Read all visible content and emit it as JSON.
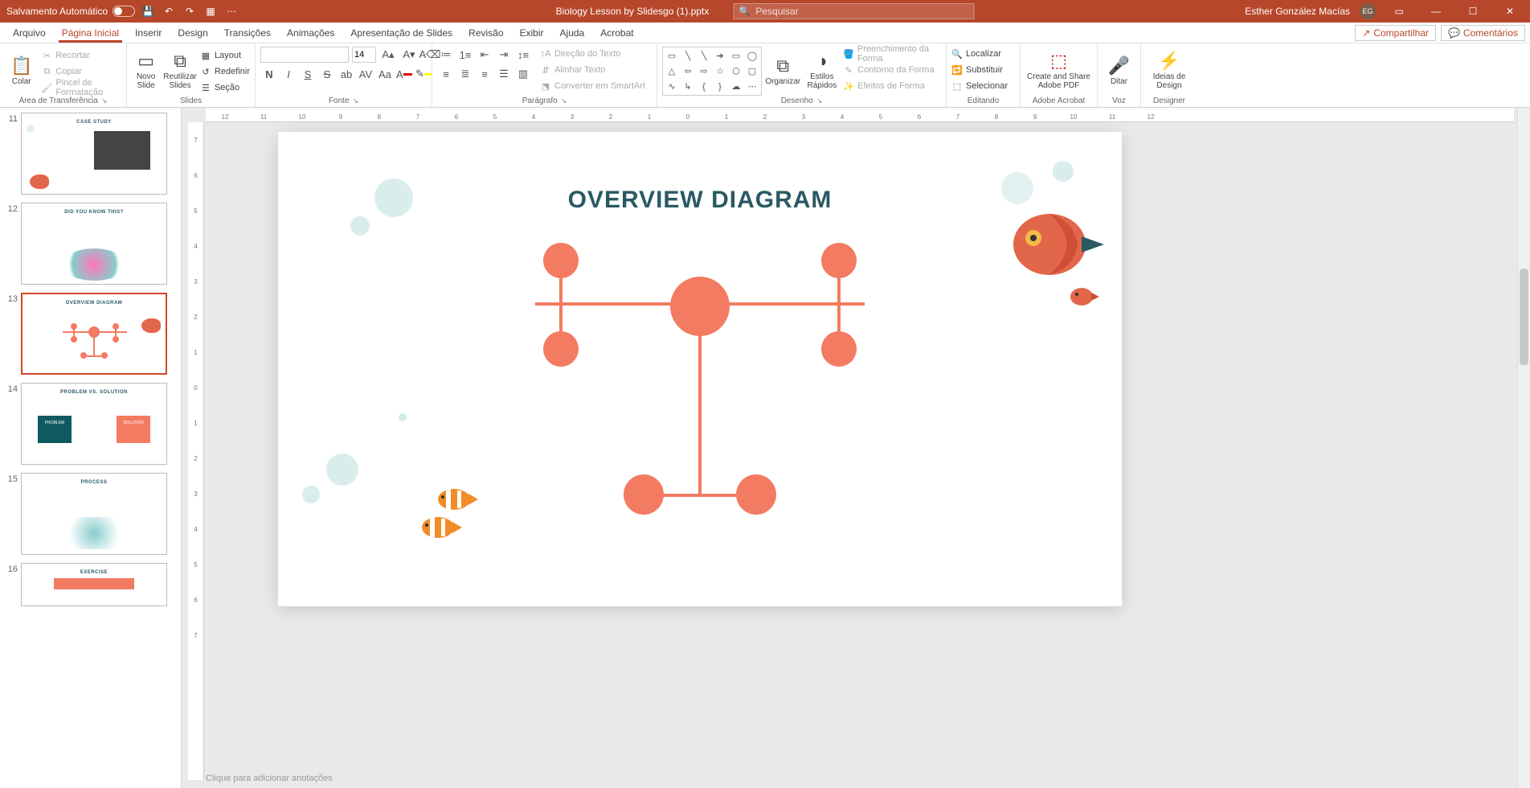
{
  "titlebar": {
    "autosave_label": "Salvamento Automático",
    "filename": "Biology Lesson by Slidesgo (1).pptx",
    "search_placeholder": "Pesquisar",
    "user_name": "Esther González Macías",
    "user_initials": "EG"
  },
  "tabs": {
    "items": [
      "Arquivo",
      "Página Inicial",
      "Inserir",
      "Design",
      "Transições",
      "Animações",
      "Apresentação de Slides",
      "Revisão",
      "Exibir",
      "Ajuda",
      "Acrobat"
    ],
    "share": "Compartilhar",
    "comments": "Comentários"
  },
  "ribbon": {
    "clipboard": {
      "paste": "Colar",
      "cut": "Recortar",
      "copy": "Copiar",
      "format_painter": "Pincel de Formatação",
      "group": "Área de Transferência"
    },
    "slides": {
      "new_slide": "Novo Slide",
      "reuse": "Reutilizar Slides",
      "layout": "Layout",
      "reset": "Redefinir",
      "section": "Seção",
      "group": "Slides"
    },
    "font": {
      "size": "14",
      "group": "Fonte"
    },
    "paragraph": {
      "direction": "Direção do Texto",
      "align": "Alinhar Texto",
      "smartart": "Converter em SmartArt",
      "group": "Parágrafo"
    },
    "drawing": {
      "arrange": "Organizar",
      "quick_styles": "Estilos Rápidos",
      "fill": "Preenchimento da Forma",
      "outline": "Contorno da Forma",
      "effects": "Efeitos de Forma",
      "group": "Desenho"
    },
    "editing": {
      "find": "Localizar",
      "replace": "Substituir",
      "select": "Selecionar",
      "group": "Editando"
    },
    "adobe": {
      "create_share": "Create and Share Adobe PDF",
      "group": "Adobe Acrobat"
    },
    "voice": {
      "dictate": "Ditar",
      "group": "Voz"
    },
    "designer": {
      "ideas": "Ideias de Design",
      "group": "Designer"
    }
  },
  "thumbs": {
    "numbers": [
      "11",
      "12",
      "13",
      "14",
      "15",
      "16"
    ],
    "titles": {
      "s11": "CASE STUDY",
      "s12": "DID YOU KNOW THIS?",
      "s13": "OVERVIEW DIAGRAM",
      "s14": "PROBLEM VS. SOLUTION",
      "s14a": "PROBLEM",
      "s14b": "SOLUTION",
      "s15": "PROCESS",
      "s16": "EXERCISE"
    }
  },
  "slide": {
    "title": "OVERVIEW DIAGRAM"
  },
  "notes": {
    "placeholder": "Clique para adicionar anotações"
  },
  "colors": {
    "accent": "#f37b62",
    "title": "#2a5964"
  }
}
